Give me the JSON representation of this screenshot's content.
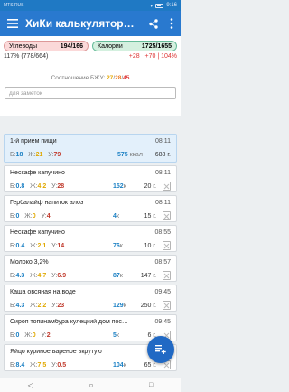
{
  "status": {
    "carrier": "MTS RUS",
    "carrier2": "Заряд батареи",
    "time": "9:16"
  },
  "appbar": {
    "title": "ХиКи калькулятор…"
  },
  "summary": {
    "carbs_label": "Углеводы",
    "carbs_value": "194/166",
    "cal_label": "Калории",
    "cal_value": "1725/1655",
    "left_text": "117% (778/664)",
    "right_a": "+28",
    "right_b": "+70",
    "right_c": "| 104%",
    "ratio_label": "Соотношение БЖУ:",
    "ratio_b": "27",
    "ratio_sep1": "/",
    "ratio_z": "28",
    "ratio_sep2": "/",
    "ratio_u": "45",
    "note_placeholder": "для заметок"
  },
  "labels": {
    "b": "Б:",
    "zh": "Ж:",
    "u": "У:",
    "kcal": "ккал"
  },
  "meal": {
    "name": "1-й прием пищи",
    "time": "08:11",
    "b": "18",
    "zh": "21",
    "u": "79",
    "kcal": "575",
    "gram": "688 г."
  },
  "items": [
    {
      "name": "Нескафе капучино",
      "time": "08:11",
      "b": "0.8",
      "zh": "4.2",
      "u": "28",
      "kcal": "152",
      "kunit": "к",
      "gram": "20 г."
    },
    {
      "name": "Гербалайф напиток алоэ",
      "time": "08:11",
      "b": "0",
      "zh": "0",
      "u": "4",
      "kcal": "4",
      "kunit": "к",
      "gram": "15 г."
    },
    {
      "name": "Нескафе капучино",
      "time": "08:55",
      "b": "0.4",
      "zh": "2.1",
      "u": "14",
      "kcal": "76",
      "kunit": "к",
      "gram": "10 г."
    },
    {
      "name": "Молоко 3,2%",
      "time": "08:57",
      "b": "4.3",
      "zh": "4.7",
      "u": "6.9",
      "kcal": "87",
      "kunit": "к",
      "gram": "147 г."
    },
    {
      "name": "Каша овсяная на воде",
      "time": "09:45",
      "b": "4.3",
      "zh": "2.2",
      "u": "23",
      "kcal": "129",
      "kunit": "к",
      "gram": "250 г."
    },
    {
      "name": "Сироп топинамбура кулецкий дом пос…",
      "time": "09:45",
      "b": "0",
      "zh": "0",
      "u": "2",
      "kcal": "5",
      "kunit": "к",
      "gram": "6 г."
    },
    {
      "name": "Яйцо куриное вареное вкрутую",
      "time": "09:45",
      "b": "8.4",
      "zh": "7.5",
      "u": "0.5",
      "kcal": "104",
      "kunit": "к",
      "gram": "65 г."
    }
  ]
}
